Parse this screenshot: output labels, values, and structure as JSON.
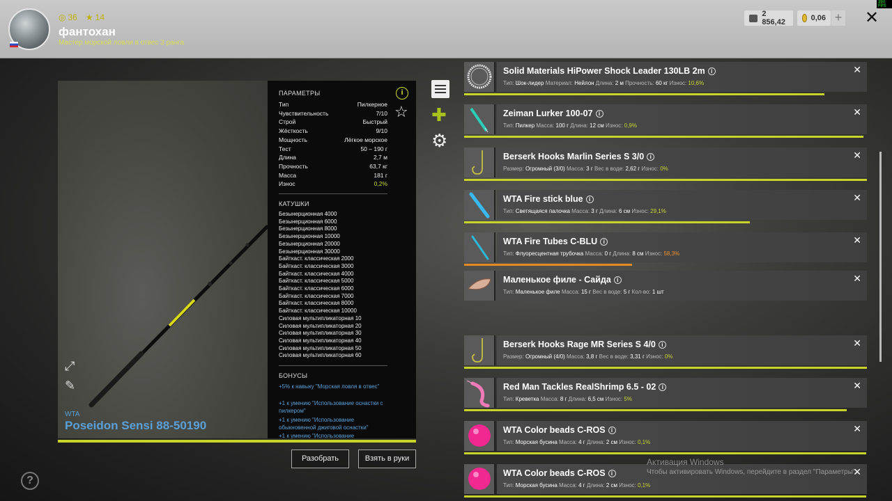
{
  "profile": {
    "level": "36",
    "rank": "14",
    "nickname": "фантохан",
    "subtitle": "Мастер морской ловли в отвес 3 ранга"
  },
  "currency": {
    "money": "2 856,42",
    "gold": "0,06",
    "plus": "+"
  },
  "rod": {
    "brand": "WTA",
    "name": "Poseidon Sensi 88-50190",
    "params_header": "ПАРАМЕТРЫ",
    "params": [
      {
        "label": "Тип",
        "value": "Пилкерное"
      },
      {
        "label": "Чувствительность",
        "value": "7/10"
      },
      {
        "label": "Строй",
        "value": "Быстрый"
      },
      {
        "label": "Жёсткость",
        "value": "9/10"
      },
      {
        "label": "Мощность",
        "value": "Лёгкое морское"
      },
      {
        "label": "Тест",
        "value": "50 – 190 г"
      },
      {
        "label": "Длина",
        "value": "2,7 м"
      },
      {
        "label": "Прочность",
        "value": "63,7 кг"
      },
      {
        "label": "Масса",
        "value": "181 г"
      },
      {
        "label": "Износ",
        "value": "0,2%"
      }
    ],
    "reels_header": "КАТУШКИ",
    "reels": [
      "Безынерционная 4000",
      "Безынерционная 6000",
      "Безынерционная 8000",
      "Безынерционная 10000",
      "Безынерционная 20000",
      "Безынерционная 30000",
      "Байткаст. классическая 2000",
      "Байткаст. классическая 3000",
      "Байткаст. классическая 4000",
      "Байткаст. классическая 5000",
      "Байткаст. классическая 6000",
      "Байткаст. классическая 7000",
      "Байткаст. классическая 8000",
      "Байткаст. классическая 10000",
      "Силовая мультипликаторная 10",
      "Силовая мультипликаторная 20",
      "Силовая мультипликаторная 30",
      "Силовая мультипликаторная 40",
      "Силовая мультипликаторная 50",
      "Силовая мультипликаторная 60"
    ],
    "bonus_header": "БОНУСЫ",
    "bonuses": [
      "+5% к навыку \"Морская ловля в отвес\"",
      "+1 к умению \"Использование оснастки с пилкером\"",
      "+1 к умению \"Использование обыкновенной джиговой оснастки\"",
      "+1 к умению \"Использование"
    ],
    "wear": 0.998
  },
  "buttons": {
    "disassemble": "Разобрать",
    "take": "Взять в руки"
  },
  "items": [
    {
      "title": "Solid Materials HiPower Shock Leader 130LB 2m",
      "meta": [
        [
          "Тип:",
          "Шок-лидер"
        ],
        [
          "Материал:",
          "Нейлон"
        ],
        [
          "Длина:",
          "2 м"
        ],
        [
          "Прочность:",
          "60 кг"
        ],
        [
          "Износ:",
          "10,6%"
        ]
      ],
      "wear_class": "g",
      "bar": 0.894,
      "bar_color": "#c7d42a",
      "thumb": "coil"
    },
    {
      "title": "Zeiman Lurker 100-07",
      "meta": [
        [
          "Тип:",
          "Пилкер"
        ],
        [
          "Масса:",
          "100 г"
        ],
        [
          "Длина:",
          "12 см"
        ],
        [
          "Износ:",
          "0,9%"
        ]
      ],
      "wear_class": "g",
      "bar": 0.991,
      "bar_color": "#c7d42a",
      "thumb": "jig"
    },
    {
      "title": "Berserk Hooks Marlin Series S 3/0",
      "meta": [
        [
          "Размер:",
          "Огромный (3/0)"
        ],
        [
          "Масса:",
          "3 г"
        ],
        [
          "Вес в воде:",
          "2,62 г"
        ],
        [
          "Износ:",
          "0%"
        ]
      ],
      "wear_class": "g",
      "bar": 1.0,
      "bar_color": "#c7d42a",
      "thumb": "hook"
    },
    {
      "title": "WTA Fire stick blue",
      "meta": [
        [
          "Тип:",
          "Светящаяся палочка"
        ],
        [
          "Масса:",
          "3 г"
        ],
        [
          "Длина:",
          "6 см"
        ],
        [
          "Износ:",
          "29,1%"
        ]
      ],
      "wear_class": "g",
      "bar": 0.709,
      "bar_color": "#c7d42a",
      "thumb": "stick"
    },
    {
      "title": "WTA Fire Tubes C-BLU",
      "meta": [
        [
          "Тип:",
          "Флуоресцентная трубочка"
        ],
        [
          "Масса:",
          "0 г"
        ],
        [
          "Длина:",
          "8 см"
        ],
        [
          "Износ:",
          "58,3%"
        ]
      ],
      "wear_class": "o",
      "bar": 0.417,
      "bar_color": "#e58a22",
      "thumb": "tube"
    },
    {
      "title": "Маленькое филе - Сайда",
      "meta": [
        [
          "Тип:",
          "Маленькое филе"
        ],
        [
          "Масса:",
          "15 г"
        ],
        [
          "Вес в воде:",
          "5 г"
        ],
        [
          "Кол-во:",
          "1 шт"
        ]
      ],
      "wear_class": "",
      "bar": 0,
      "bar_color": "#c7d42a",
      "thumb": "fillet"
    },
    {
      "title": "Berserk Hooks Rage MR Series S 4/0",
      "meta": [
        [
          "Размер:",
          "Огромный (4/0)"
        ],
        [
          "Масса:",
          "3,8 г"
        ],
        [
          "Вес в воде:",
          "3,31 г"
        ],
        [
          "Износ:",
          "0%"
        ]
      ],
      "wear_class": "g",
      "bar": 1.0,
      "bar_color": "#c7d42a",
      "thumb": "hook"
    },
    {
      "title": "Red Man Tackles RealShrimp 6.5 - 02",
      "meta": [
        [
          "Тип:",
          "Креветка"
        ],
        [
          "Масса:",
          "8 г"
        ],
        [
          "Длина:",
          "6,5 см"
        ],
        [
          "Износ:",
          "5%"
        ]
      ],
      "wear_class": "g",
      "bar": 0.95,
      "bar_color": "#c7d42a",
      "thumb": "shrimp"
    },
    {
      "title": "WTA Color beads C-ROS",
      "meta": [
        [
          "Тип:",
          "Морская бусина"
        ],
        [
          "Масса:",
          "4 г"
        ],
        [
          "Длина:",
          "2 см"
        ],
        [
          "Износ:",
          "0,1%"
        ]
      ],
      "wear_class": "g",
      "bar": 0.999,
      "bar_color": "#c7d42a",
      "thumb": "bead"
    },
    {
      "title": "WTA Color beads C-ROS",
      "meta": [
        [
          "Тип:",
          "Морская бусина"
        ],
        [
          "Масса:",
          "4 г"
        ],
        [
          "Длина:",
          "2 см"
        ],
        [
          "Износ:",
          "0,1%"
        ]
      ],
      "wear_class": "g",
      "bar": 0.999,
      "bar_color": "#c7d42a",
      "thumb": "bead"
    }
  ],
  "watermark": {
    "title": "Активация Windows",
    "text": "Чтобы активировать Windows, перейдите в раздел \"Параметры\"."
  },
  "icons": [
    "close-icon",
    "info-icon",
    "star-icon",
    "document-icon",
    "puzzle-icon",
    "gear-icon",
    "expand-icon",
    "pencil-icon",
    "help-icon"
  ],
  "fps": "350 FPS"
}
